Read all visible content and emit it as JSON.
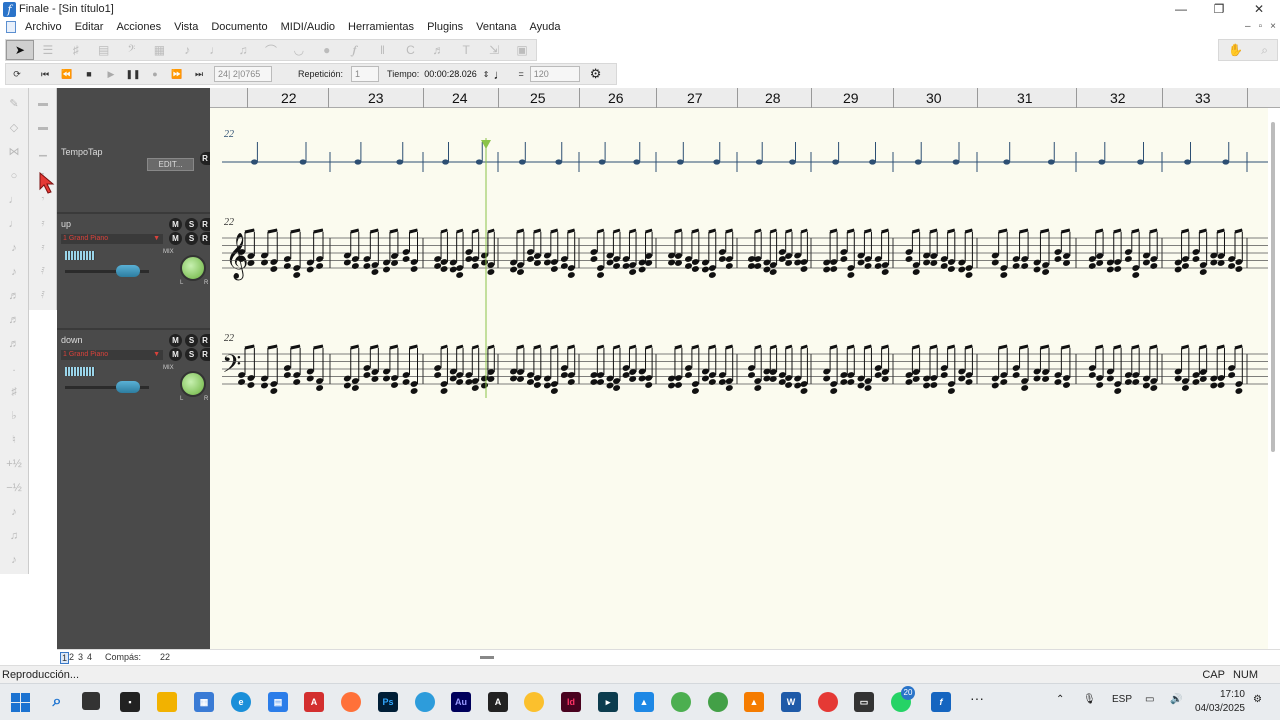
{
  "window": {
    "title": "Finale - [Sin título1]",
    "minimize": "—",
    "maximize": "❐",
    "close": "✕"
  },
  "menu": {
    "items": [
      "Archivo",
      "Editar",
      "Acciones",
      "Vista",
      "Documento",
      "MIDI/Audio",
      "Herramientas",
      "Plugins",
      "Ventana",
      "Ayuda"
    ],
    "mdi_minimize": "–",
    "mdi_restore": "▫",
    "mdi_close": "×"
  },
  "playback": {
    "position": "24| 2|0765",
    "repeat_label": "Repetición:",
    "repeat_value": "1",
    "time_label": "Tiempo:",
    "time_value": "00:00:28.026",
    "equals": "=",
    "tempo_value": "120"
  },
  "mixer": {
    "tempo_track": "TempoTap",
    "edit_button": "EDIT...",
    "strips": [
      {
        "name": "up",
        "instrument": "1 Grand Piano",
        "volume": 0.75
      },
      {
        "name": "down",
        "instrument": "1 Grand Piano",
        "volume": 0.75
      }
    ],
    "mute": "M",
    "solo": "S",
    "record": "R",
    "mix_label": "MIX",
    "left": "L",
    "right": "R"
  },
  "ruler": {
    "measures": [
      "22",
      "23",
      "24",
      "25",
      "26",
      "27",
      "28",
      "29",
      "30",
      "31",
      "32",
      "33"
    ]
  },
  "score": {
    "measure_label": "22",
    "staff_treble_measure": "22",
    "staff_bass_measure": "22",
    "playhead_measure": "24",
    "background": "#fbfbef",
    "note_color": "#111111",
    "tempo_color": "#2d4f73",
    "playhead_color": "#8bc34a"
  },
  "footer": {
    "pages": [
      "1",
      "2",
      "3",
      "4"
    ],
    "measure_label": "Compás:",
    "measure_value": "22"
  },
  "status": {
    "message": "Reproducción...",
    "caps": "CAP",
    "num": "NUM"
  },
  "taskbar": {
    "language": "ESP",
    "time": "17:10",
    "date": "04/03/2025",
    "badge": "20",
    "more": "···"
  }
}
